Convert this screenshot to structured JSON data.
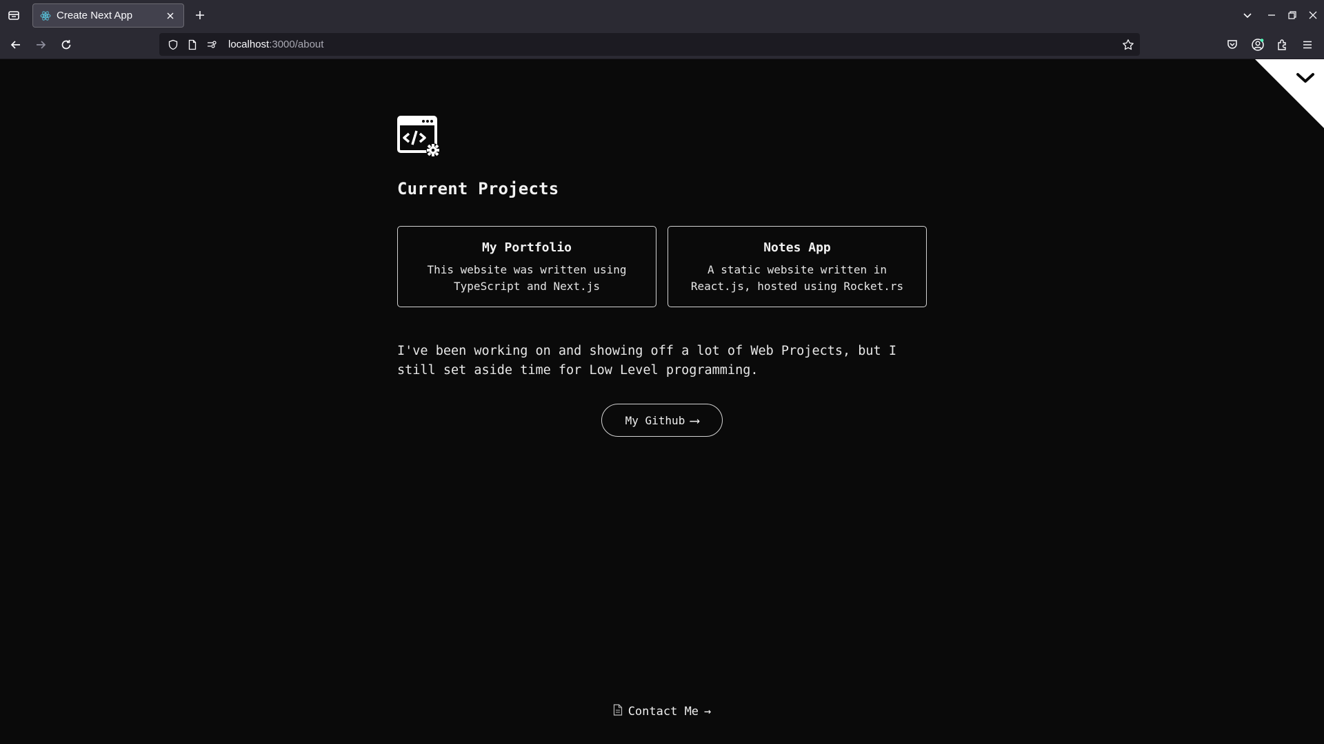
{
  "browser": {
    "tab_title": "Create Next App",
    "url_host": "localhost",
    "url_path": ":3000/about"
  },
  "icons": {
    "tab_list": "tab-list-icon",
    "favicon": "react-icon",
    "close": "close-icon",
    "new_tab": "plus-icon",
    "back": "back-arrow-icon",
    "forward": "forward-arrow-icon",
    "reload": "reload-icon",
    "shield": "shield-icon",
    "page": "page-icon",
    "permissions": "permissions-icon",
    "bookmark": "star-icon",
    "pocket": "pocket-icon",
    "account": "account-icon",
    "extensions": "puzzle-icon",
    "menu": "hamburger-menu-icon",
    "logo": "code-window-gear-icon",
    "contact": "document-icon",
    "corner": "chevron-down-icon"
  },
  "page": {
    "heading": "Current Projects",
    "projects": [
      {
        "title": "My Portfolio",
        "description": "This website was written using TypeScript and Next.js"
      },
      {
        "title": "Notes App",
        "description": "A static website written in React.js, hosted using Rocket.rs"
      }
    ],
    "blurb": "I've been working on and showing off a lot of Web Projects, but I still set aside time for Low Level programming.",
    "github_button": {
      "label": "My Github",
      "arrow": "⟶"
    },
    "contact": {
      "label": "Contact Me",
      "arrow": "→"
    }
  },
  "colors": {
    "background": "#0a0a0a",
    "chrome": "#2b2a33",
    "text": "#ececec",
    "border": "#d4d4d4"
  }
}
